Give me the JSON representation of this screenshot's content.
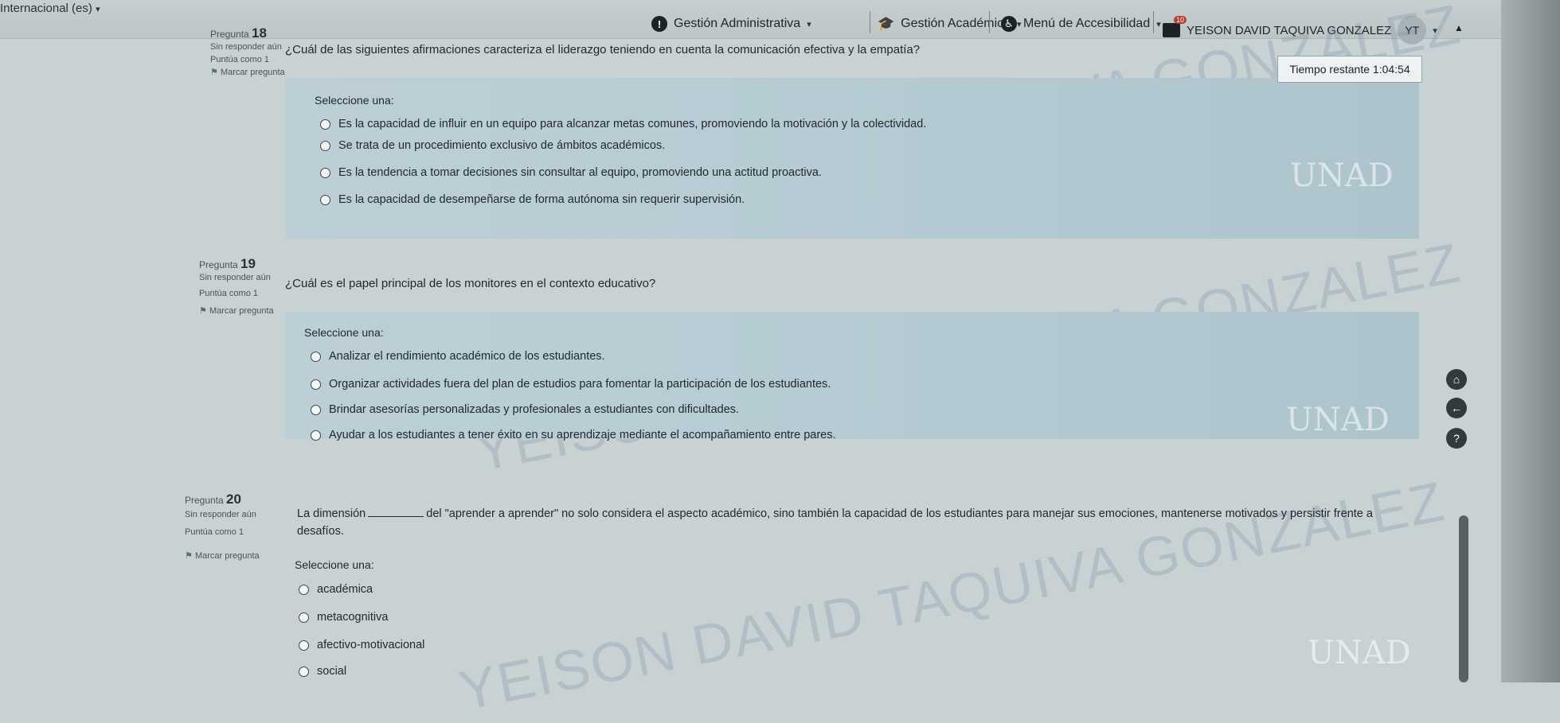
{
  "topbar": {
    "language": "Internacional (es)",
    "nav": [
      {
        "label": "Gestión Administrativa"
      },
      {
        "label": "Gestión Académica"
      },
      {
        "label": "Menú de Accesibilidad"
      }
    ],
    "user_name": "YEISON DAVID TAQUIVA GONZALEZ",
    "user_initials": "YT",
    "notification_count": "10"
  },
  "timer": {
    "label": "Tiempo restante",
    "value": "1:04:54"
  },
  "watermark": "YEISON DAVID TAQUIVA GONZALEZ",
  "logo": "UNAD",
  "questions": [
    {
      "label": "Pregunta",
      "number": "18",
      "status": "Sin responder aún",
      "points": "Puntúa como 1",
      "flag": "Marcar pregunta",
      "text": "¿Cuál de las siguientes afirmaciones caracteriza el liderazgo teniendo en cuenta la comunicación efectiva y la empatía?",
      "select_label": "Seleccione una:",
      "options": [
        "Es la capacidad de influir en un equipo para alcanzar metas comunes, promoviendo la motivación y la colectividad.",
        "Se trata de un procedimiento exclusivo de ámbitos académicos.",
        "Es la tendencia a tomar decisiones sin consultar al equipo, promoviendo una actitud proactiva.",
        "Es la capacidad de desempeñarse de forma autónoma sin requerir supervisión."
      ]
    },
    {
      "label": "Pregunta",
      "number": "19",
      "status": "Sin responder aún",
      "points": "Puntúa como 1",
      "flag": "Marcar pregunta",
      "text": "¿Cuál es el papel principal de los monitores en el contexto educativo?",
      "select_label": "Seleccione una:",
      "options": [
        "Analizar el rendimiento académico de los estudiantes.",
        "Organizar actividades fuera del plan de estudios para fomentar la participación de los estudiantes.",
        "Brindar asesorías personalizadas y profesionales a estudiantes con dificultades.",
        "Ayudar a los estudiantes a tener éxito en su aprendizaje mediante el acompañamiento entre pares."
      ]
    },
    {
      "label": "Pregunta",
      "number": "20",
      "status": "Sin responder aún",
      "points": "Puntúa como 1",
      "flag": "Marcar pregunta",
      "text_before": "La dimensión",
      "text_after": "del \"aprender a aprender\" no solo considera el aspecto académico, sino también la capacidad de los estudiantes para manejar sus emociones, mantenerse motivados y persistir frente a",
      "text_line2": "desafíos.",
      "select_label": "Seleccione una:",
      "options": [
        "académica",
        "metacognitiva",
        "afectivo-motivacional",
        "social"
      ]
    }
  ]
}
